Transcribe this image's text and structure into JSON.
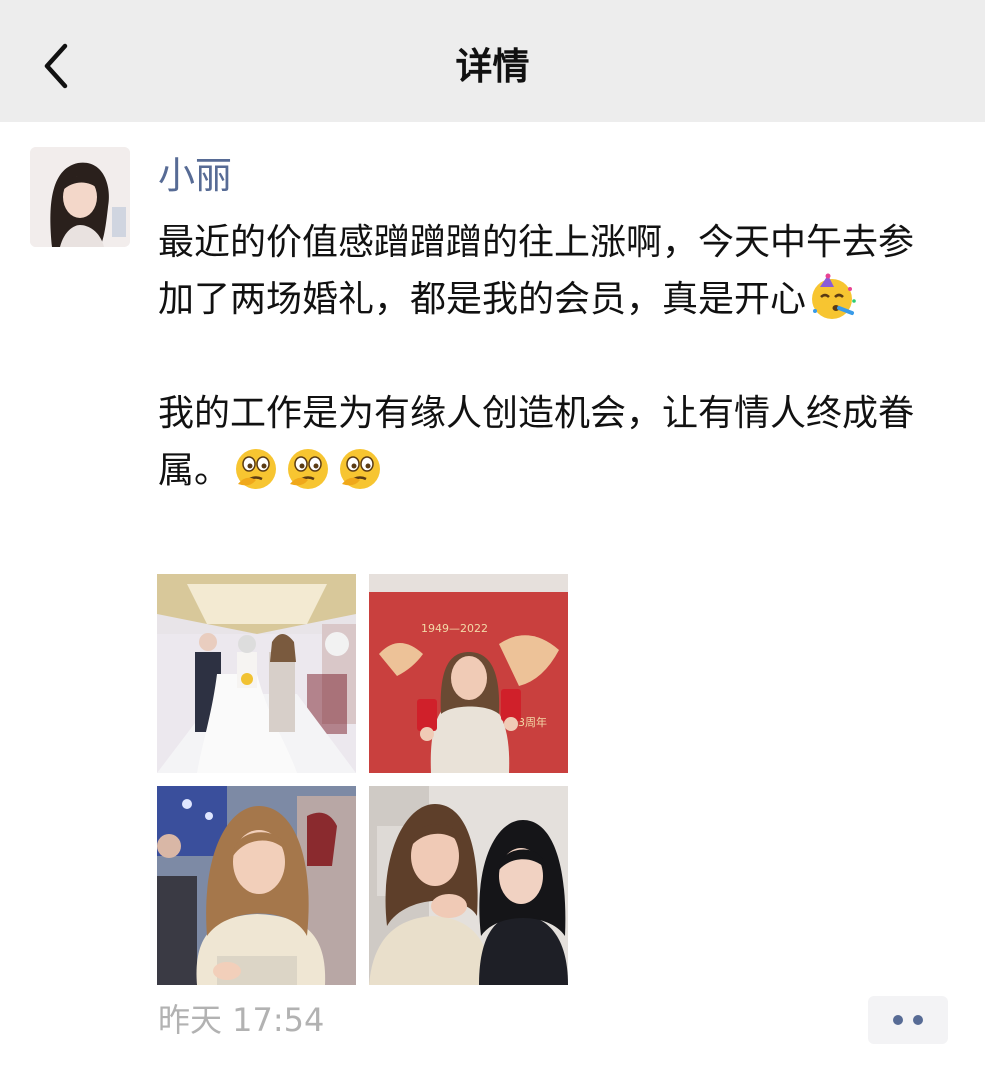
{
  "header": {
    "title": "详情",
    "back_icon": "chevron-left-icon",
    "background": "#ededed"
  },
  "post": {
    "author": "小丽",
    "paragraphs": [
      {
        "text": "最近的价值感蹭蹭蹭的往上涨啊，今天中午去参加了两场婚礼，都是我的会员，真是开心",
        "emojis": [
          "partying-face-emoji"
        ]
      },
      {
        "text": "我的工作是为有缘人创造机会，让有情人终成眷属。",
        "emojis": [
          "thinking-face-emoji",
          "thinking-face-emoji",
          "thinking-face-emoji"
        ]
      }
    ],
    "photos": [
      {
        "name": "wedding-hall-photo"
      },
      {
        "name": "red-banner-photo"
      },
      {
        "name": "banquet-selfie-photo"
      },
      {
        "name": "two-women-selfie-photo"
      }
    ],
    "photo_banner_text": {
      "years": "1949—2022",
      "anniversary": "73周年"
    },
    "timestamp": "昨天 17:54",
    "more_icon": "more-dots-icon"
  },
  "colors": {
    "name_link": "#576b95",
    "text": "#111111",
    "timestamp": "#b2b2b2"
  }
}
